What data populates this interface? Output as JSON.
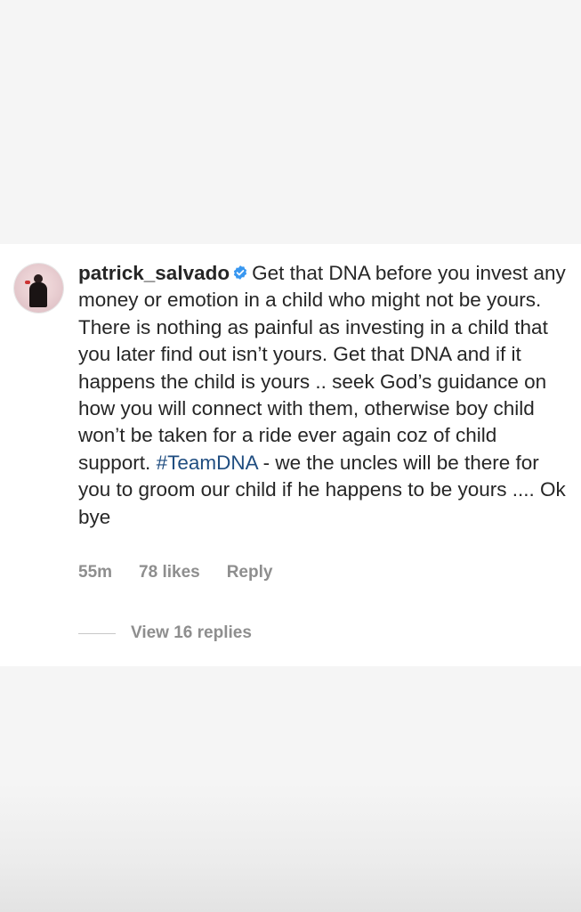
{
  "comment": {
    "username": "patrick_salvado",
    "verified_icon": "verified-badge-icon",
    "text_before_hashtag": "Get that DNA before you invest any money or emotion in a child who might not be yours. There is nothing as painful as investing in a child that you later find out isn’t yours. Get that DNA and if it happens the child is yours .. seek God’s guidance on how you will connect with them, otherwise boy child won’t be taken for a ride ever again coz of child support.",
    "hashtag": "#TeamDNA",
    "text_after_hashtag": "- we the uncles will be there for you to groom our child if he happens to be yours .... Ok bye",
    "time": "55m",
    "likes": "78 likes",
    "reply_label": "Reply",
    "view_replies_label": "View 16 replies"
  },
  "colors": {
    "verified": "#3897f0",
    "hashtag": "#1f4d80",
    "meta": "#8e8e8e",
    "text": "#262626"
  }
}
